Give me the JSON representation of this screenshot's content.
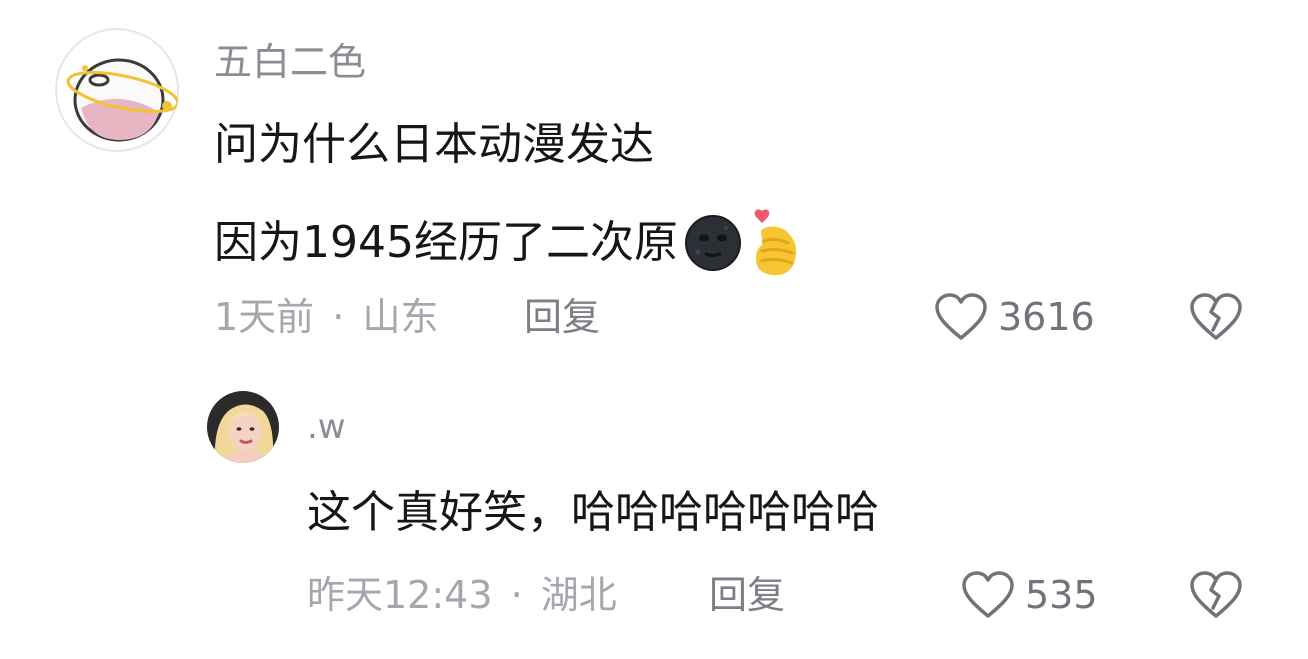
{
  "comments": [
    {
      "username": "五白二色",
      "lines": [
        "问为什么日本动漫发达",
        "因为1945经历了二次原"
      ],
      "emojis": [
        "new-moon-face-emoji",
        "hand-heart-emoji"
      ],
      "time": "1天前",
      "separator": "·",
      "location": "山东",
      "reply_label": "回复",
      "likes": "3616"
    },
    {
      "username": ".w",
      "lines": [
        "这个真好笑，哈哈哈哈哈哈哈"
      ],
      "time": "昨天12:43",
      "separator": "·",
      "location": "湖北",
      "reply_label": "回复",
      "likes": "535"
    }
  ],
  "icons": {
    "like": "heart-outline-icon",
    "dislike": "broken-heart-icon"
  },
  "colors": {
    "text": "#161616",
    "username": "#8a8d93",
    "meta": "#a4a7ad",
    "icon": "#6f737a"
  }
}
